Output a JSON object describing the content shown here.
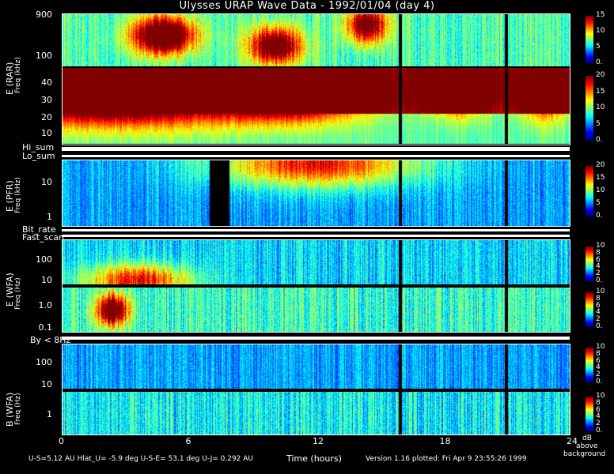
{
  "title": "Ulysses URAP Wave Data - 1992/01/04  (day 4)",
  "xlabel": "Time (hours)",
  "x_ticks": [
    "0",
    "6",
    "12",
    "18",
    "24"
  ],
  "colorbar_unit": [
    "dB",
    "above",
    "background"
  ],
  "footer": {
    "left": "U-S=5.12 AU   Hlat_U= -5.9 deg   U-S-E= 53.1 deg   U-J= 0.292 AU",
    "right": "Version 1.16 plotted: Fri Apr  9 23:55:26 1999"
  },
  "labels": {
    "rar_group": "E (RAR)",
    "pfr_group": "E (PFR)",
    "wfa_e_group": "E (WFA)",
    "wfa_b_group": "B (WFA)",
    "freq_khz": "Freq (kHz)",
    "freq_hz": "Freq (Hz)",
    "hi_sum": "Hi_sum",
    "lo_sum": "Lo_sum",
    "bit_rate": "Bit_rate",
    "fast_scan": "Fast_scan",
    "by_8hz": "By < 8Hz"
  },
  "chart_data": {
    "type": "heatmap",
    "title": "Ulysses URAP Wave Data - 1992/01/04  (day 4)",
    "xlabel": "Time (hours)",
    "xlim": [
      0,
      24
    ],
    "panels": [
      {
        "name": "RAR high",
        "ylabel": "Freq (kHz)",
        "yticks": [
          "900",
          "100"
        ],
        "scale": "log",
        "colorbar": [
          "15",
          "10",
          "5",
          "0."
        ],
        "clim": [
          0,
          15
        ]
      },
      {
        "name": "RAR low",
        "ylabel": "Freq (kHz)",
        "yticks": [
          "40",
          "30",
          "20",
          "10"
        ],
        "scale": "linear",
        "colorbar": [
          "20",
          "15",
          "10",
          "5",
          "0."
        ],
        "clim": [
          0,
          20
        ]
      },
      {
        "name": "PFR",
        "ylabel": "Freq (kHz)",
        "yticks": [
          "10",
          "1"
        ],
        "scale": "log",
        "colorbar": [
          "20",
          "15",
          "10",
          "5",
          "0."
        ],
        "clim": [
          0,
          20
        ]
      },
      {
        "name": "WFA E high",
        "ylabel": "Freq (Hz)",
        "yticks": [
          "100",
          "10"
        ],
        "scale": "log",
        "colorbar": [
          "10",
          "8",
          "6",
          "4",
          "2",
          "0."
        ],
        "clim": [
          0,
          10
        ]
      },
      {
        "name": "WFA E low",
        "ylabel": "Freq (Hz)",
        "yticks": [
          "1.0",
          "0.1"
        ],
        "scale": "log",
        "colorbar": [
          "10",
          "8",
          "6",
          "4",
          "2",
          "0."
        ],
        "clim": [
          0,
          10
        ]
      },
      {
        "name": "WFA B high",
        "ylabel": "Freq (Hz)",
        "yticks": [
          "100",
          "10"
        ],
        "scale": "log",
        "colorbar": [
          "10",
          "8",
          "6",
          "4",
          "2",
          "0."
        ],
        "clim": [
          0,
          10
        ]
      },
      {
        "name": "WFA B low",
        "ylabel": "Freq (Hz)",
        "yticks": [
          "1"
        ],
        "scale": "log",
        "colorbar": [
          "10",
          "8",
          "6",
          "4",
          "2",
          "0."
        ],
        "clim": [
          0,
          10
        ]
      }
    ]
  }
}
